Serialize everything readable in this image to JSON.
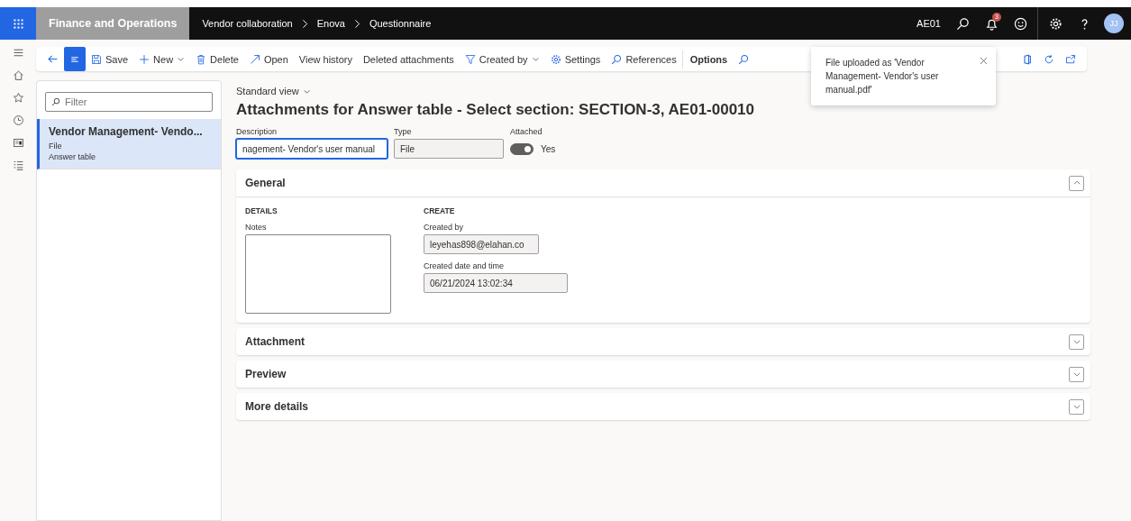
{
  "app": {
    "title": "Finance and Operations"
  },
  "breadcrumb": [
    "Vendor collaboration",
    "Enova",
    "Questionnaire"
  ],
  "company": "AE01",
  "notifications": {
    "count": "3"
  },
  "user": {
    "initials": "JJ"
  },
  "toolbar": [
    {
      "kind": "back"
    },
    {
      "kind": "menu",
      "selected": true
    },
    {
      "kind": "action",
      "label": "Save",
      "dropdown": false
    },
    {
      "kind": "action",
      "label": "New",
      "dropdown": true
    },
    {
      "kind": "action",
      "label": "Delete",
      "dropdown": false
    },
    {
      "kind": "action",
      "label": "Open",
      "dropdown": false
    },
    {
      "kind": "action",
      "label": "View history",
      "dropdown": false
    },
    {
      "kind": "action",
      "label": "Deleted attachments",
      "dropdown": false
    },
    {
      "kind": "action",
      "label": "Created by",
      "dropdown": true
    },
    {
      "kind": "action",
      "label": "Settings",
      "dropdown": false
    },
    {
      "kind": "action",
      "label": "References",
      "dropdown": false
    },
    {
      "kind": "group",
      "label": "Options"
    },
    {
      "kind": "search"
    }
  ],
  "filter": {
    "placeholder": "Filter"
  },
  "list": [
    {
      "title": "Vendor Management- Vendo...",
      "line_1": "File",
      "line_2": "Answer table",
      "selected": true
    }
  ],
  "view": "Standard view",
  "title": "Attachments for Answer table - Select section: SECTION-3, AE01-00010",
  "header_fields": [
    {
      "kind": "text",
      "label": "Description",
      "value": "nagement- Vendor's user manual",
      "readonly": false
    },
    {
      "kind": "text",
      "label": "Type",
      "value": "File",
      "readonly": true
    },
    {
      "kind": "toggle",
      "label": "Attached",
      "on": true,
      "value": "Yes"
    }
  ],
  "sections": [
    {
      "title": "General",
      "expanded": true,
      "groups": [
        {
          "heading": "DETAILS",
          "fields": [
            {
              "kind": "textarea",
              "label": "Notes"
            }
          ]
        },
        {
          "heading": "CREATE",
          "fields": [
            {
              "kind": "text",
              "label": "Created by",
              "value": "leyehas898@elahan.co",
              "readonly": true
            },
            {
              "kind": "text",
              "label": "Created date and time",
              "value": "06/21/2024 13:02:34",
              "readonly": true
            }
          ]
        }
      ]
    },
    {
      "title": "Attachment",
      "expanded": false
    },
    {
      "title": "Preview",
      "expanded": false
    },
    {
      "title": "More details",
      "expanded": false
    }
  ],
  "toast": {
    "message": "File uploaded as 'Vendor Management- Vendor's user manual.pdf'"
  }
}
